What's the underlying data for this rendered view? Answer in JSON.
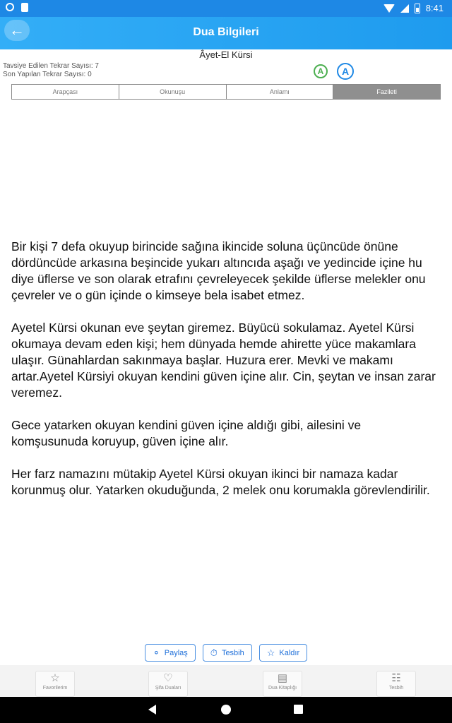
{
  "statusbar": {
    "time": "8:41"
  },
  "appbar": {
    "back_icon": "arrow-left-icon",
    "title": "Dua Bilgileri"
  },
  "subject": {
    "title": "Âyet-El Kürsi"
  },
  "counts": {
    "recommended": "Tavsiye Edilen Tekrar Sayısı: 7",
    "last": "Son Yapılan Tekrar Sayısı: 0"
  },
  "font_controls": {
    "decrease_label": "A",
    "increase_label": "A"
  },
  "tabs": [
    {
      "label": "Arapçası"
    },
    {
      "label": "Okunuşu"
    },
    {
      "label": "Anlamı"
    },
    {
      "label": "Fazileti"
    }
  ],
  "content": {
    "paragraphs": [
      "Bir kişi 7 defa okuyup birincide sağına ikincide soluna üçüncüde önüne dördüncüde arkasına beşincide yukarı altıncıda aşağı ve yedincide içine hu diye üflerse ve son olarak etrafını çevreleyecek şekilde üflerse melekler onu çevreler ve o gün içinde o kimseye bela isabet etmez.",
      "Ayetel Kürsi okunan eve şeytan giremez. Büyücü sokulamaz. Ayetel Kürsi okumaya devam eden kişi; hem dünyada hemde ahirette yüce makamlara ulaşır. Günahlardan sakınmaya başlar. Huzura erer. Mevki ve makamı artar.Ayetel Kürsiyi okuyan kendini güven içine alır. Cin, şeytan ve insan zarar veremez.",
      "Gece yatarken okuyan kendini güven içine aldığı gibi, ailesini ve komşusunuda koruyup, güven içine alır.",
      "Her farz namazını mütakip Ayetel Kürsi okuyan ikinci bir namaza kadar korunmuş olur. Yatarken okuduğunda, 2 melek onu korumakla görevlendirilir."
    ]
  },
  "actions": {
    "share_label": "Paylaş",
    "tesbih_label": "Tesbih",
    "remove_label": "Kaldır"
  },
  "bottom_nav": [
    {
      "label": "Favorilerim",
      "icon": "star-icon"
    },
    {
      "label": "Şifa Duaları",
      "icon": "book-heart-icon"
    },
    {
      "label": "Dua Kitaplığı",
      "icon": "library-icon"
    },
    {
      "label": "Tesbih",
      "icon": "counter-icon"
    }
  ]
}
